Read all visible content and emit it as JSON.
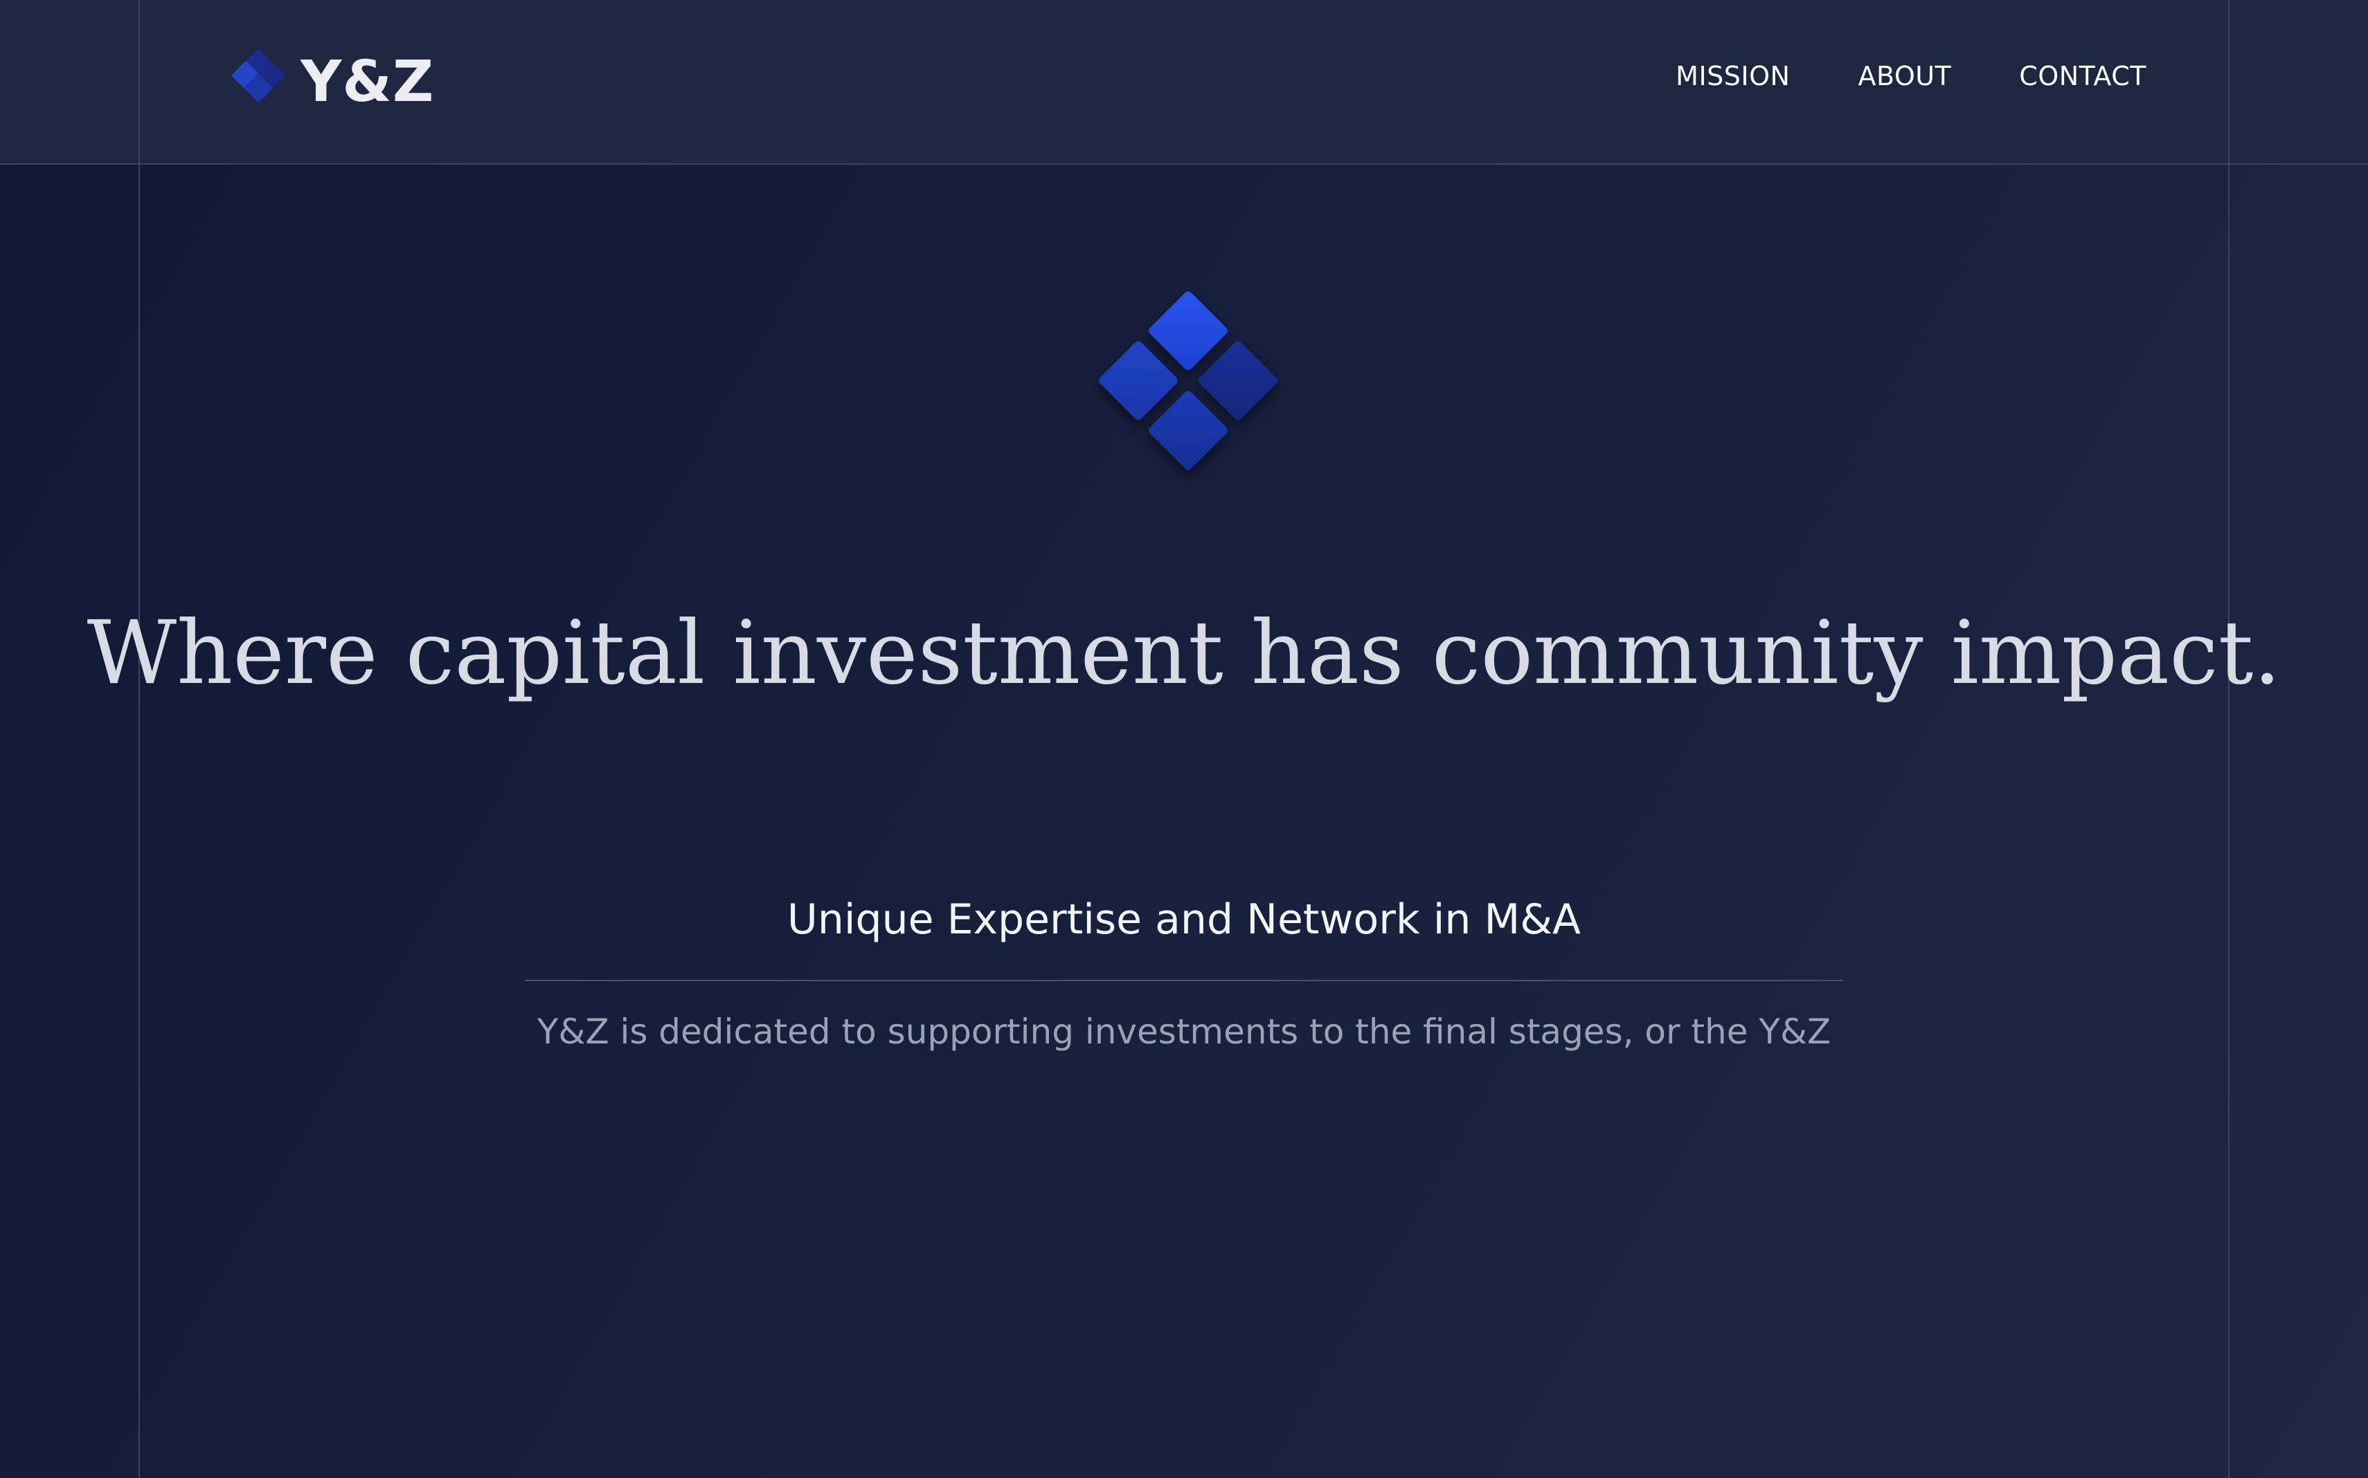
{
  "brand": {
    "name": "Y&Z",
    "logo_icon": "diamond-cluster-icon"
  },
  "nav": {
    "items": [
      {
        "label": "MISSION"
      },
      {
        "label": "ABOUT"
      },
      {
        "label": "CONTACT"
      }
    ]
  },
  "hero": {
    "icon": "diamond-cluster-icon",
    "headline": "Where capital investment has community impact.",
    "subheading": "Unique Expertise and Network in M&A",
    "description": "Y&Z is dedicated to supporting investments to the final stages, or the Y&Z"
  },
  "colors": {
    "background": "#161f3c",
    "header": "#1e2740",
    "accent_blue": "#2149d9",
    "accent_blue_dark": "#162c8f",
    "headline_text": "#d9dbe4",
    "muted_text": "#9ba2b6"
  }
}
